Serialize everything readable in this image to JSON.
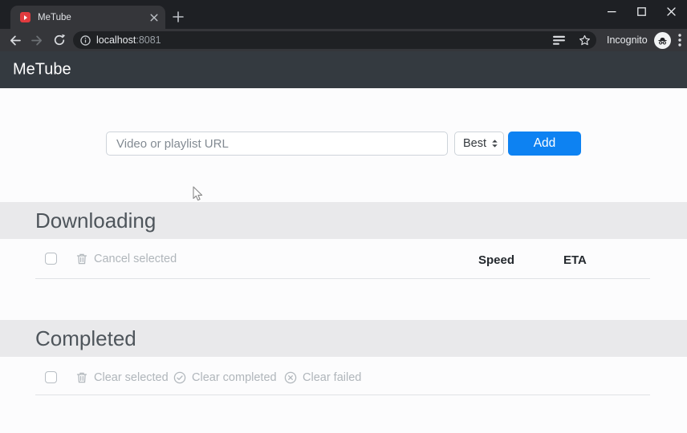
{
  "browser": {
    "tab_title": "MeTube",
    "url_host": "localhost",
    "url_port": ":8081",
    "incognito_label": "Incognito"
  },
  "app": {
    "navbar_title": "MeTube",
    "form": {
      "url_placeholder": "Video or playlist URL",
      "quality_selected": "Best",
      "add_label": "Add"
    },
    "downloading": {
      "title": "Downloading",
      "actions": [
        {
          "icon": "trash-icon",
          "label": "Cancel selected"
        }
      ],
      "columns": {
        "speed": "Speed",
        "eta": "ETA"
      }
    },
    "completed": {
      "title": "Completed",
      "actions": [
        {
          "icon": "trash-icon",
          "label": "Clear selected"
        },
        {
          "icon": "check-circle-icon",
          "label": "Clear completed"
        },
        {
          "icon": "x-circle-icon",
          "label": "Clear failed"
        }
      ]
    }
  },
  "icons": {
    "favicon": "metube-red-play",
    "tab_close": "x",
    "new_tab": "+",
    "minimize": "dash",
    "maximize": "square",
    "close": "x",
    "back": "arrow-left",
    "forward": "arrow-right",
    "reload": "circular-arrow",
    "site_info": "info-circle",
    "reading_list": "lines",
    "bookmark": "star-outline",
    "incognito": "spy-hat-glasses",
    "menu": "three-dots-vertical",
    "cursor": "arrow-pointer"
  },
  "colors": {
    "accent_blue": "#0d82f2",
    "navbar_bg": "#343a40",
    "tabstrip_bg": "#1e2024",
    "toolbar_bg": "#35363a",
    "omnibox_bg": "#1f2124",
    "band_bg": "#e9e9eb",
    "muted_text": "#b0b6bb",
    "header_text": "#4e555b"
  }
}
